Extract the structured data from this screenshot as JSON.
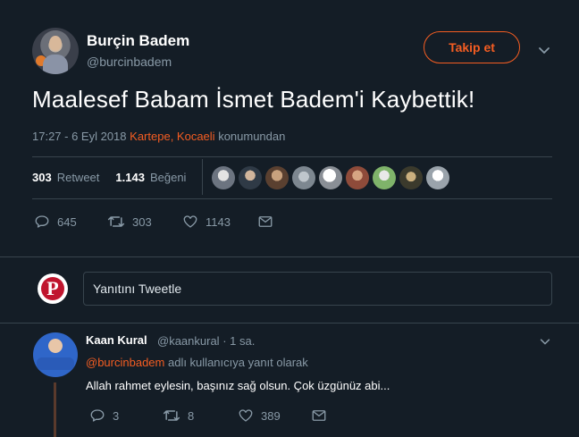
{
  "user": {
    "name": "Burçin Badem",
    "handle": "@burcinbadem",
    "follow_label": "Takip et"
  },
  "tweet": {
    "text": "Maalesef Babam İsmet Badem'i Kaybettik!",
    "time": "17:27 - 6 Eyl 2018",
    "location": "Kartepe, Kocaeli",
    "location_suffix": "konumundan",
    "retweet_count": "303",
    "retweet_label": "Retweet",
    "like_count": "1.143",
    "like_label": "Beğeni",
    "likers_count_shown": 9,
    "actions": {
      "reply_count": "645",
      "retweet_count": "303",
      "like_count": "1143"
    }
  },
  "reply_box": {
    "placeholder": "Yanıtını Tweetle",
    "avatar_letter": "P"
  },
  "reply": {
    "name": "Kaan Kural",
    "handle": "@kaankural",
    "time": "· 1 sa.",
    "reply_to_handle": "@burcinbadem",
    "reply_to_suffix": "adlı kullanıcıya yanıt olarak",
    "text": "Allah rahmet eylesin, başınız sağ olsun. Çok üzgünüz abi...",
    "actions": {
      "reply_count": "3",
      "retweet_count": "8",
      "like_count": "389"
    }
  },
  "colors": {
    "background": "#141d26",
    "accent": "#f45d22",
    "muted": "#8899a6",
    "border": "#38444d"
  }
}
